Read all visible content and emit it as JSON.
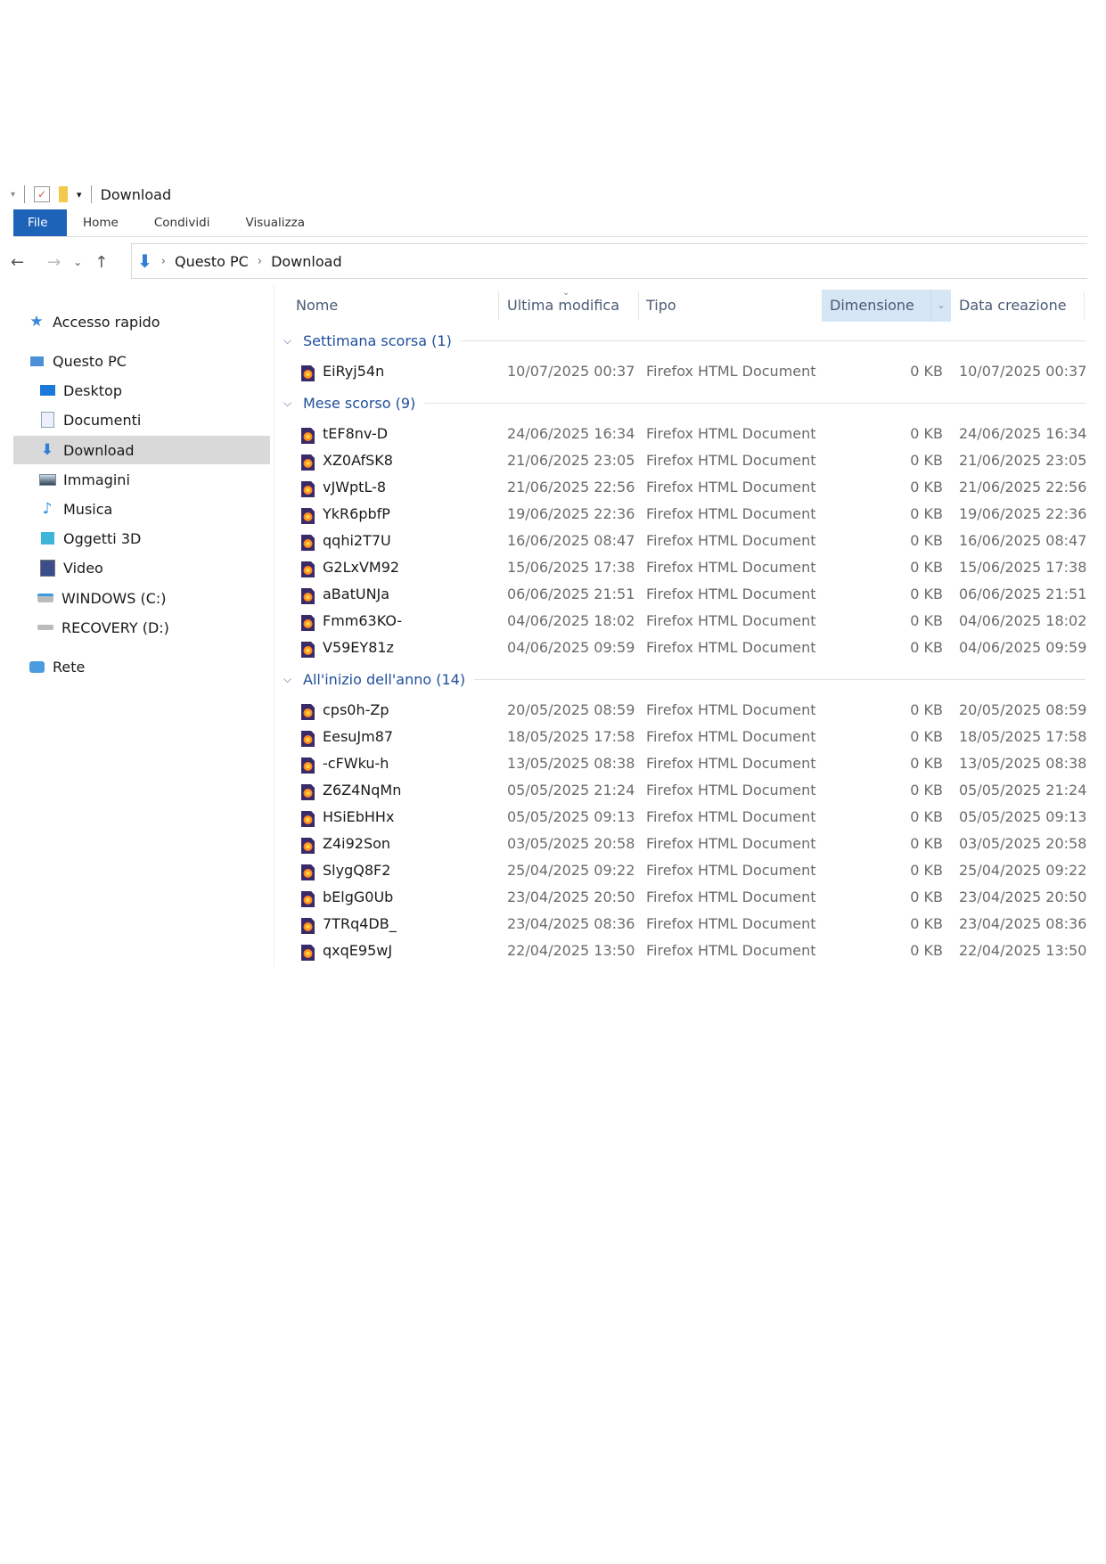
{
  "window": {
    "title": "Download"
  },
  "ribbon": {
    "tabs": [
      "File",
      "Home",
      "Condividi",
      "Visualizza"
    ]
  },
  "address": {
    "crumbs": [
      "Questo PC",
      "Download"
    ]
  },
  "sidebar": {
    "items": [
      {
        "label": "Accesso rapido",
        "icon": "star-icon"
      },
      {
        "label": "Questo PC",
        "icon": "computer-icon"
      },
      {
        "label": "Desktop",
        "icon": "desktop-icon"
      },
      {
        "label": "Documenti",
        "icon": "documents-icon"
      },
      {
        "label": "Download",
        "icon": "download-icon",
        "selected": true
      },
      {
        "label": "Immagini",
        "icon": "pictures-icon"
      },
      {
        "label": "Musica",
        "icon": "music-icon"
      },
      {
        "label": "Oggetti 3D",
        "icon": "3d-objects-icon"
      },
      {
        "label": "Video",
        "icon": "video-icon"
      },
      {
        "label": "WINDOWS (C:)",
        "icon": "drive-c-icon"
      },
      {
        "label": "RECOVERY (D:)",
        "icon": "drive-d-icon"
      },
      {
        "label": "Rete",
        "icon": "network-icon"
      }
    ]
  },
  "columns": {
    "name": "Nome",
    "modified": "Ultima modifica",
    "type": "Tipo",
    "size": "Dimensione",
    "created": "Data creazione"
  },
  "groups": [
    {
      "label": "Settimana scorsa (1)",
      "files": [
        {
          "name": "EiRyj54n",
          "modified": "10/07/2025 00:37",
          "type": "Firefox HTML Document",
          "size": "0 KB",
          "created": "10/07/2025 00:37"
        }
      ]
    },
    {
      "label": "Mese scorso (9)",
      "files": [
        {
          "name": "tEF8nv-D",
          "modified": "24/06/2025 16:34",
          "type": "Firefox HTML Document",
          "size": "0 KB",
          "created": "24/06/2025 16:34"
        },
        {
          "name": "XZ0AfSK8",
          "modified": "21/06/2025 23:05",
          "type": "Firefox HTML Document",
          "size": "0 KB",
          "created": "21/06/2025 23:05"
        },
        {
          "name": "vJWptL-8",
          "modified": "21/06/2025 22:56",
          "type": "Firefox HTML Document",
          "size": "0 KB",
          "created": "21/06/2025 22:56"
        },
        {
          "name": "YkR6pbfP",
          "modified": "19/06/2025 22:36",
          "type": "Firefox HTML Document",
          "size": "0 KB",
          "created": "19/06/2025 22:36"
        },
        {
          "name": "qqhi2T7U",
          "modified": "16/06/2025 08:47",
          "type": "Firefox HTML Document",
          "size": "0 KB",
          "created": "16/06/2025 08:47"
        },
        {
          "name": "G2LxVM92",
          "modified": "15/06/2025 17:38",
          "type": "Firefox HTML Document",
          "size": "0 KB",
          "created": "15/06/2025 17:38"
        },
        {
          "name": "aBatUNJa",
          "modified": "06/06/2025 21:51",
          "type": "Firefox HTML Document",
          "size": "0 KB",
          "created": "06/06/2025 21:51"
        },
        {
          "name": "Fmm63KO-",
          "modified": "04/06/2025 18:02",
          "type": "Firefox HTML Document",
          "size": "0 KB",
          "created": "04/06/2025 18:02"
        },
        {
          "name": "V59EY81z",
          "modified": "04/06/2025 09:59",
          "type": "Firefox HTML Document",
          "size": "0 KB",
          "created": "04/06/2025 09:59"
        }
      ]
    },
    {
      "label": "All'inizio dell'anno (14)",
      "files": [
        {
          "name": "cps0h-Zp",
          "modified": "20/05/2025 08:59",
          "type": "Firefox HTML Document",
          "size": "0 KB",
          "created": "20/05/2025 08:59"
        },
        {
          "name": "EesuJm87",
          "modified": "18/05/2025 17:58",
          "type": "Firefox HTML Document",
          "size": "0 KB",
          "created": "18/05/2025 17:58"
        },
        {
          "name": "-cFWku-h",
          "modified": "13/05/2025 08:38",
          "type": "Firefox HTML Document",
          "size": "0 KB",
          "created": "13/05/2025 08:38"
        },
        {
          "name": "Z6Z4NqMn",
          "modified": "05/05/2025 21:24",
          "type": "Firefox HTML Document",
          "size": "0 KB",
          "created": "05/05/2025 21:24"
        },
        {
          "name": "HSiEbHHx",
          "modified": "05/05/2025 09:13",
          "type": "Firefox HTML Document",
          "size": "0 KB",
          "created": "05/05/2025 09:13"
        },
        {
          "name": "Z4i92Son",
          "modified": "03/05/2025 20:58",
          "type": "Firefox HTML Document",
          "size": "0 KB",
          "created": "03/05/2025 20:58"
        },
        {
          "name": "SlygQ8F2",
          "modified": "25/04/2025 09:22",
          "type": "Firefox HTML Document",
          "size": "0 KB",
          "created": "25/04/2025 09:22"
        },
        {
          "name": "bElgG0Ub",
          "modified": "23/04/2025 20:50",
          "type": "Firefox HTML Document",
          "size": "0 KB",
          "created": "23/04/2025 20:50"
        },
        {
          "name": "7TRq4DB_",
          "modified": "23/04/2025 08:36",
          "type": "Firefox HTML Document",
          "size": "0 KB",
          "created": "23/04/2025 08:36"
        },
        {
          "name": "qxqE95wJ",
          "modified": "22/04/2025 13:50",
          "type": "Firefox HTML Document",
          "size": "0 KB",
          "created": "22/04/2025 13:50"
        }
      ]
    }
  ],
  "colors": {
    "accent": "#1d63b8",
    "group": "#1f4e9b",
    "selected": "#d9d9d9",
    "sorted_header": "#d6e6f5"
  }
}
